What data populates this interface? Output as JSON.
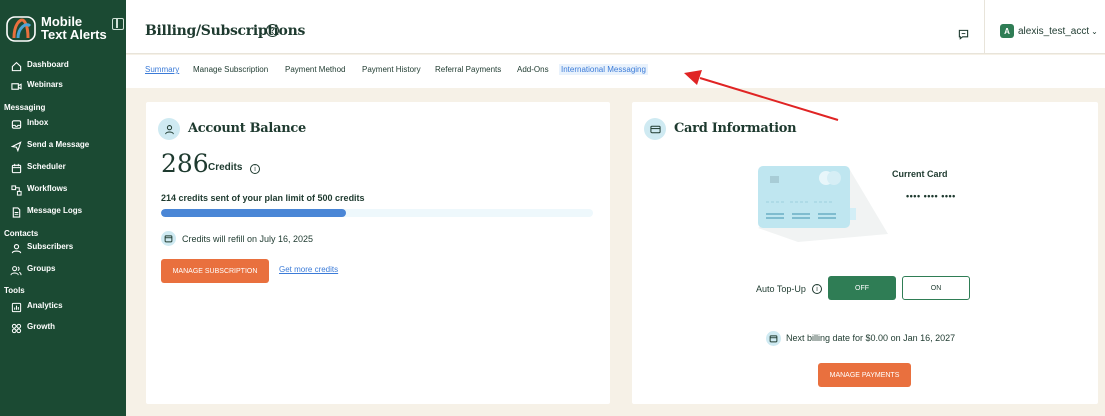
{
  "sidebar": {
    "brand": {
      "line1": "Mobile",
      "line2": "Text Alerts"
    },
    "items": [
      {
        "label": "Dashboard",
        "icon": "home-icon"
      },
      {
        "label": "Webinars",
        "icon": "video-icon"
      }
    ],
    "messaging": {
      "section": "Messaging",
      "items": [
        {
          "label": "Inbox",
          "icon": "inbox-icon"
        },
        {
          "label": "Send a Message",
          "icon": "send-icon"
        },
        {
          "label": "Scheduler",
          "icon": "calendar-icon"
        },
        {
          "label": "Workflows",
          "icon": "workflow-icon"
        },
        {
          "label": "Message Logs",
          "icon": "log-icon"
        }
      ]
    },
    "contacts": {
      "section": "Contacts",
      "items": [
        {
          "label": "Subscribers",
          "icon": "person-icon"
        },
        {
          "label": "Groups",
          "icon": "group-icon"
        }
      ]
    },
    "tools": {
      "section": "Tools",
      "items": [
        {
          "label": "Analytics",
          "icon": "chart-icon"
        },
        {
          "label": "Growth",
          "icon": "grid-icon"
        }
      ]
    }
  },
  "header": {
    "title": "Billing/Subscriptions",
    "help": "?",
    "account": {
      "initial": "A",
      "name": "alexis_test_acct",
      "chevron": "⌄"
    }
  },
  "tabs": [
    {
      "label": "Summary",
      "state": "active"
    },
    {
      "label": "Manage Subscription"
    },
    {
      "label": "Payment Method"
    },
    {
      "label": "Payment History"
    },
    {
      "label": "Referral Payments"
    },
    {
      "label": "Add-Ons"
    },
    {
      "label": "International Messaging",
      "state": "highlighted"
    }
  ],
  "account_balance": {
    "title": "Account Balance",
    "credits": "286",
    "credits_label": "Credits",
    "info": "i",
    "plan_text": "214 credits sent of your plan limit of 500 credits",
    "progress_fraction": 0.428,
    "refill_text": "Credits will refill on July 16, 2025",
    "manage_button": "MANAGE SUBSCRIPTION",
    "more_link": "Get more credits"
  },
  "card_information": {
    "title": "Card Information",
    "current_card_label": "Current Card",
    "card_mask": "•••• •••• ••••",
    "auto_topup_label": "Auto Top-Up",
    "info": "i",
    "off_label": "OFF",
    "on_label": "ON",
    "auto_topup_state": "OFF",
    "billing_text": "Next billing date for $0.00 on Jan 16, 2027",
    "manage_button": "MANAGE PAYMENTS"
  },
  "colors": {
    "sidebar_bg": "#1b4a33",
    "accent_green": "#2f7d55",
    "accent_orange": "#e9703e",
    "link_blue": "#3b7bd8",
    "page_bg": "#f6f1e7",
    "annotation_arrow": "#e02424"
  }
}
